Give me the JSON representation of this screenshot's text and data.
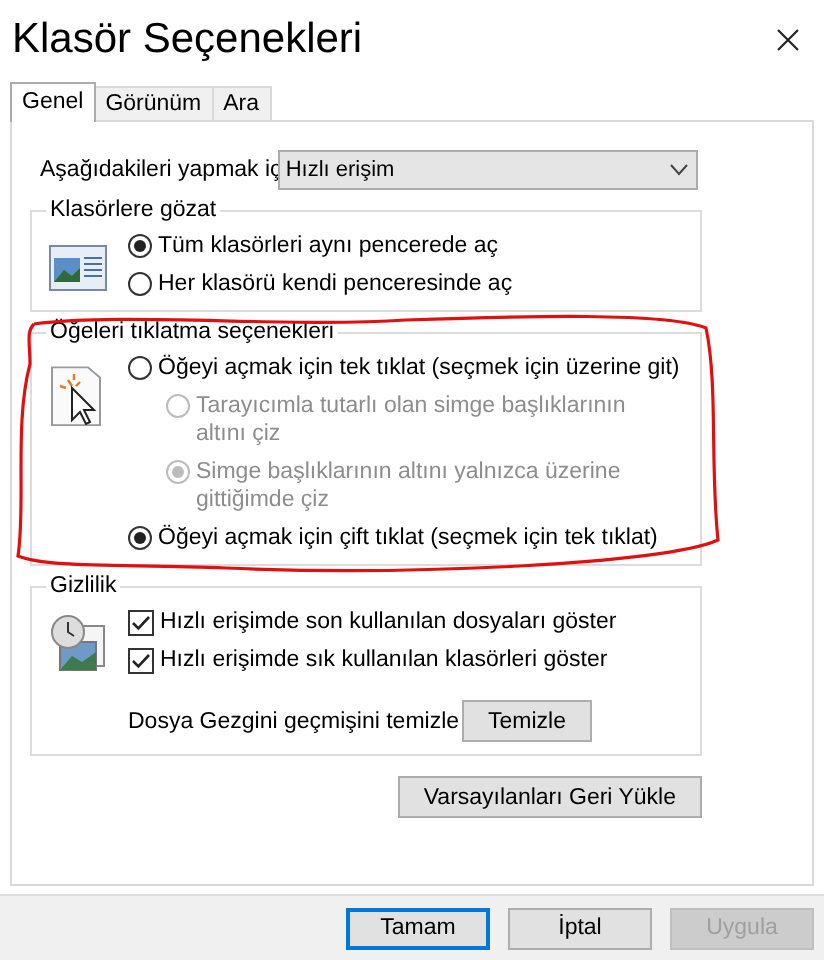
{
  "window": {
    "title": "Klasör Seçenekleri"
  },
  "tabs": [
    {
      "label": "Genel",
      "selected": true
    },
    {
      "label": "Görünüm",
      "selected": false
    },
    {
      "label": "Ara",
      "selected": false
    }
  ],
  "open_in": {
    "label": "Aşağıdakileri yapmak iç",
    "value": "Hızlı erişim"
  },
  "groups": [
    {
      "kind": "browse",
      "title": "Klasörlere gözat",
      "options": [
        {
          "kind": "radio",
          "label": "Tüm klasörleri aynı pencerede aç",
          "selected": true,
          "disabled": false
        },
        {
          "kind": "radio",
          "label": "Her klasörü kendi penceresinde aç",
          "selected": false,
          "disabled": false
        }
      ]
    },
    {
      "kind": "click",
      "title": "Öğeleri tıklatma seçenekleri",
      "options": [
        {
          "kind": "radio",
          "label": "Öğeyi açmak için tek tıklat (seçmek için üzerine git)",
          "selected": false,
          "disabled": false,
          "children": [
            {
              "kind": "radio",
              "label": "Tarayıcımla tutarlı olan simge başlıklarının altını çiz",
              "selected": false,
              "disabled": true
            },
            {
              "kind": "radio",
              "label": "Simge başlıklarının altını yalnızca üzerine gittiğimde çiz",
              "selected": true,
              "disabled": true
            }
          ]
        },
        {
          "kind": "radio",
          "label": "Öğeyi açmak için çift tıklat (seçmek için tek tıklat)",
          "selected": true,
          "disabled": false
        }
      ]
    },
    {
      "kind": "privacy",
      "title": "Gizlilik",
      "options": [
        {
          "kind": "checkbox",
          "label": "Hızlı erişimde son kullanılan dosyaları göster",
          "checked": true
        },
        {
          "kind": "checkbox",
          "label": "Hızlı erişimde sık kullanılan klasörleri göster",
          "checked": true
        }
      ],
      "clear_history": {
        "label": "Dosya Gezgini geçmişini temizle",
        "button": "Temizle"
      }
    }
  ],
  "restore_button": "Varsayılanları Geri Yükle",
  "buttons": [
    {
      "label": "Tamam",
      "default": true,
      "disabled": false
    },
    {
      "label": "İptal",
      "default": false,
      "disabled": false
    },
    {
      "label": "Uygula",
      "default": false,
      "disabled": true
    }
  ],
  "annotation": {
    "kind": "outline"
  }
}
